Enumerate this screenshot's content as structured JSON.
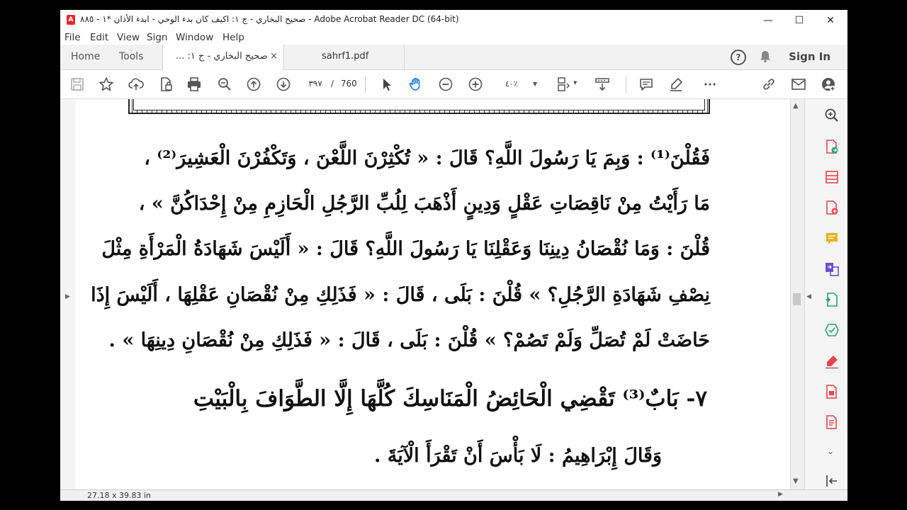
{
  "window": {
    "title": "صحيح البخاري - ج ١: اكيف كان بدء الوحي - ابدء الأذان *١ - ٨٨٥ - Adobe Acrobat Reader DC (64-bit)",
    "app_icon": "acrobat-icon",
    "minimize": "—",
    "maximize": "☐",
    "close": "✕"
  },
  "menu": [
    "File",
    "Edit",
    "View",
    "Sign",
    "Window",
    "Help"
  ],
  "tabs": {
    "home": "Home",
    "tools": "Tools",
    "doc1": "صحيح البخاري - ج ١: ...",
    "doc1_close": "×",
    "doc2": "sahrf1.pdf",
    "help": "?",
    "sign_in": "Sign In"
  },
  "toolbar": {
    "page_current": "٣٩٧",
    "page_sep": "/",
    "page_total": "760",
    "zoom": "٤٠٪"
  },
  "document": {
    "lines": [
      "فَقُلْنَ⁽¹⁾ : وَبِمَ يَا رَسُولَ اللَّهِ؟ قَالَ : « تُكْثِرْنَ اللَّعْنَ ، وَتَكْفُرْنَ الْعَشِيرَ⁽²⁾ ،",
      "مَا رَأَيْتُ مِنْ نَاقِصَاتِ عَقْلٍ وَدِينٍ أَذْهَبَ لِلُبِّ الرَّجُلِ الْحَازِمِ مِنْ إِحْدَاكُنَّ » ،",
      "قُلْنَ : وَمَا نُقْصَانُ دِينِنَا وَعَقْلِنَا يَا رَسُولَ اللَّهِ؟ قَالَ : « أَلَيْسَ شَهَادَةُ الْمَرْأَةِ مِثْلَ",
      "نِصْفِ شَهَادَةِ الرَّجُلِ؟ » قُلْنَ : بَلَى ، قَالَ : « فَذَلِكِ مِنْ نُقْصَانِ عَقْلِهَا ، أَلَيْسَ إِذَا",
      "حَاضَتْ لَمْ تُصَلِّ وَلَمْ تَصُمْ؟ » قُلْنَ : بَلَى ، قَالَ : « فَذَلِكِ مِنْ نُقْصَانِ دِينِهَا » ."
    ],
    "heading": "٧- بَابٌ⁽³⁾ تَقْضِي الْحَائِضُ الْمَنَاسِكَ كُلَّهَا إِلَّا الطَّوَافَ بِالْبَيْتِ",
    "last_line": "وَقَالَ إِبْرَاهِيمُ : لَا بَأْسَ أَنْ تَقْرَأَ الْآيَةَ ."
  },
  "status": {
    "page_size": "27.18 x 39.83 in"
  },
  "colors": {
    "accent_blue": "#1473e6",
    "icon_red": "#e34850",
    "icon_green": "#2d9d78",
    "icon_yellow": "#e8b51e",
    "icon_purple": "#6e4fd3"
  }
}
